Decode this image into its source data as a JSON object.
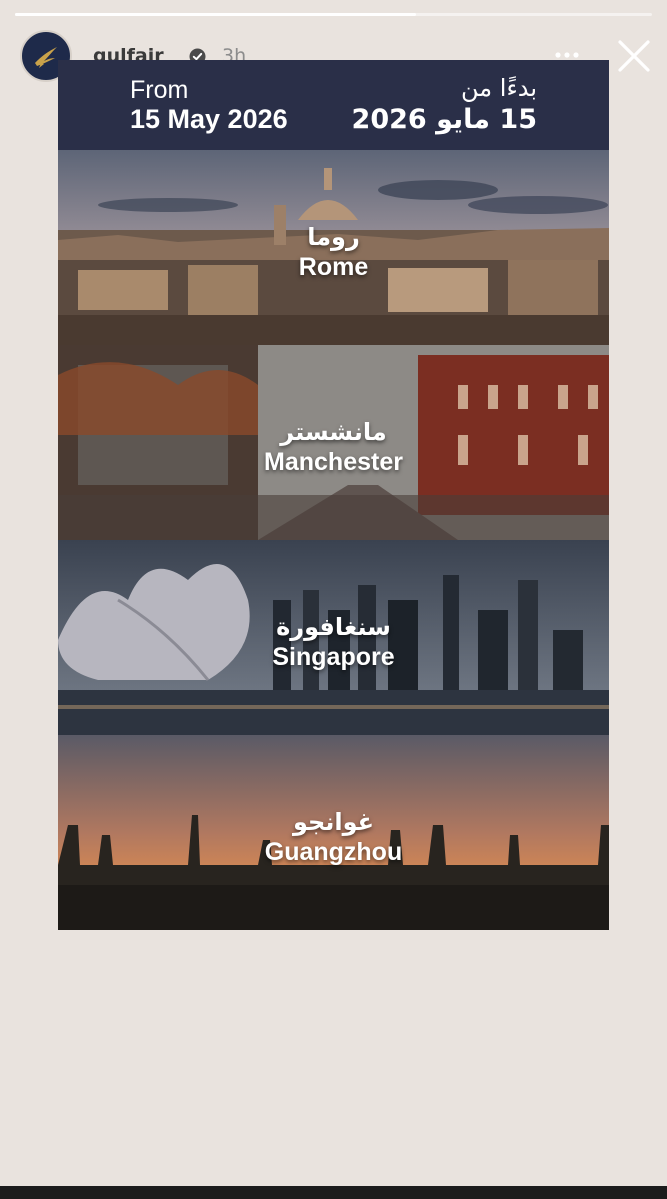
{
  "story": {
    "progress_fraction": 0.63
  },
  "header": {
    "username": "gulfair",
    "timestamp": "3h",
    "verified": true,
    "avatar_icon": "gulf-air-falcon-logo",
    "more_icon": "more-horizontal-icon",
    "close_icon": "close-icon"
  },
  "banner": {
    "from_label": "From",
    "from_date": "15 May 2026",
    "ar_label": "بدءًا من",
    "ar_date": "15 مايو 2026"
  },
  "cities": [
    {
      "ar": "روما",
      "en": "Rome"
    },
    {
      "ar": "مانشستر",
      "en": "Manchester"
    },
    {
      "ar": "سنغافورة",
      "en": "Singapore"
    },
    {
      "ar": "غوانجو",
      "en": "Guangzhou"
    }
  ],
  "colors": {
    "banner": "#2a2f48",
    "background": "#e9e3de",
    "avatar": "#1e2a4a",
    "brand_gold": "#c9a24a"
  }
}
